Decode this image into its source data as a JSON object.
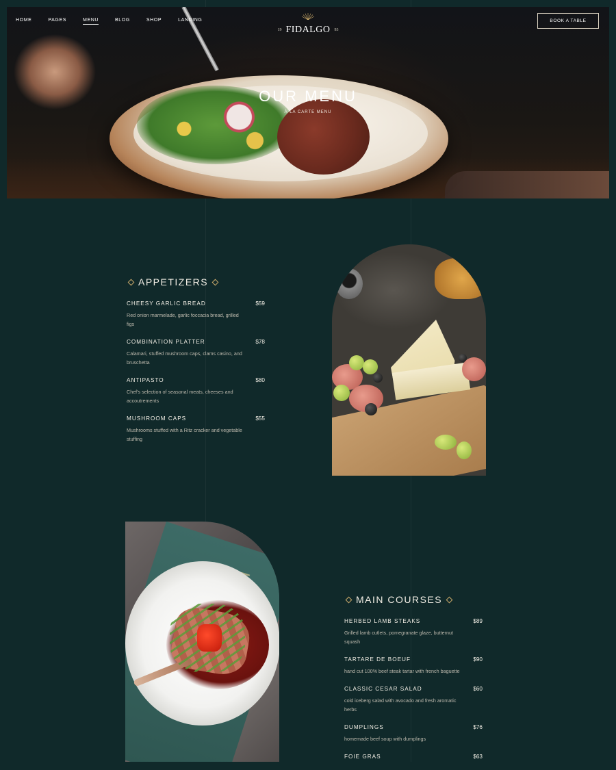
{
  "nav": {
    "items": [
      {
        "label": "HOME"
      },
      {
        "label": "PAGES"
      },
      {
        "label": "MENU",
        "active": true
      },
      {
        "label": "BLOG"
      },
      {
        "label": "SHOP"
      },
      {
        "label": "LANDING"
      }
    ],
    "book_label": "BOOK A TABLE"
  },
  "logo": {
    "year_left": "19",
    "name": "FIDALGO",
    "year_right": "93"
  },
  "hero": {
    "title": "OUR MENU",
    "subtitle": "À LA CARTE MENU"
  },
  "appetizers": {
    "title": "APPETIZERS",
    "items": [
      {
        "name": "CHEESY GARLIC BREAD",
        "price": "$59",
        "desc": "Red onion marmelade, garlic foccacia bread, grilled figs"
      },
      {
        "name": "COMBINATION PLATTER",
        "price": "$78",
        "desc": "Calamari, stuffed mushroom caps, clams casino, and bruschetta"
      },
      {
        "name": "ANTIPASTO",
        "price": "$80",
        "desc": "Chef's selection of seasonal meats, cheeses and accoutrements"
      },
      {
        "name": "MUSHROOM CAPS",
        "price": "$55",
        "desc": "Mushrooms stuffed with a Ritz cracker and vegetable stuffing"
      }
    ]
  },
  "main_courses": {
    "title": "MAIN COURSES",
    "items": [
      {
        "name": "HERBED LAMB STEAKS",
        "price": "$89",
        "desc": "Grilled lamb cutlets, pomegranate glaze, butternut squash"
      },
      {
        "name": "TARTARE DE BOEUF",
        "price": "$90",
        "desc": "hand cut 100% beef steak tartar with french baguette"
      },
      {
        "name": "CLASSIC CESAR SALAD",
        "price": "$60",
        "desc": "cold iceberg salad with avocado and fresh aromatic herbs"
      },
      {
        "name": "DUMPLINGS",
        "price": "$76",
        "desc": "homemade beef soup with dumplings"
      },
      {
        "name": "FOIE GRAS",
        "price": "$63",
        "desc": ""
      }
    ]
  },
  "colors": {
    "background": "#10292a",
    "accent": "#c9a96a",
    "text": "#f3efe6",
    "muted_text": "#bdb9ad"
  }
}
